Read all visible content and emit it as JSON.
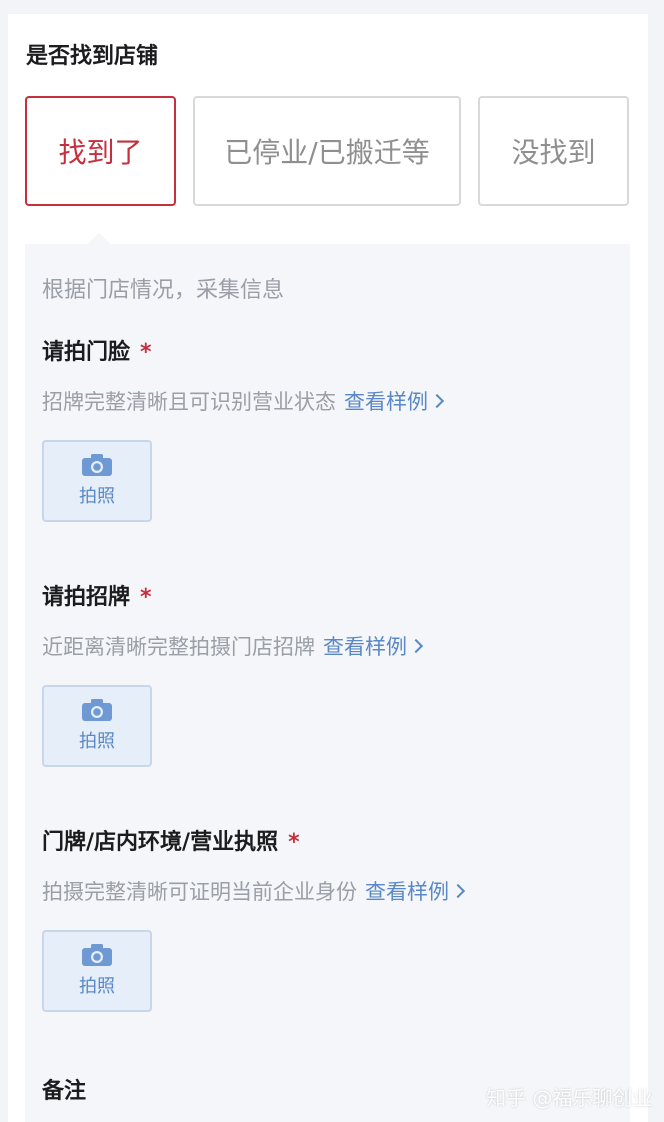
{
  "question": {
    "title": "是否找到店铺"
  },
  "options": [
    {
      "label": "找到了",
      "selected": true
    },
    {
      "label": "已停业/已搬迁等",
      "selected": false
    },
    {
      "label": "没找到",
      "selected": false
    }
  ],
  "panel": {
    "hint": "根据门店情况，采集信息",
    "fields": [
      {
        "title": "请拍门脸",
        "required_mark": "*",
        "desc": "招牌完整清晰且可识别营业状态",
        "example_link": "查看样例",
        "photo_label": "拍照"
      },
      {
        "title": "请拍招牌",
        "required_mark": "*",
        "desc": "近距离清晰完整拍摄门店招牌",
        "example_link": "查看样例",
        "photo_label": "拍照"
      },
      {
        "title": "门牌/店内环境/营业执照",
        "required_mark": "*",
        "desc": "拍摄完整清晰可证明当前企业身份",
        "example_link": "查看样例",
        "photo_label": "拍照"
      }
    ],
    "remarks_title": "备注"
  },
  "watermark": "知乎 @福乐聊创业",
  "colors": {
    "accent_red": "#c62f3e",
    "link_blue": "#5a88c6",
    "photo_bg": "#e6eef9"
  },
  "icons": {
    "camera": "camera-icon",
    "chevron": "chevron-right-icon"
  }
}
